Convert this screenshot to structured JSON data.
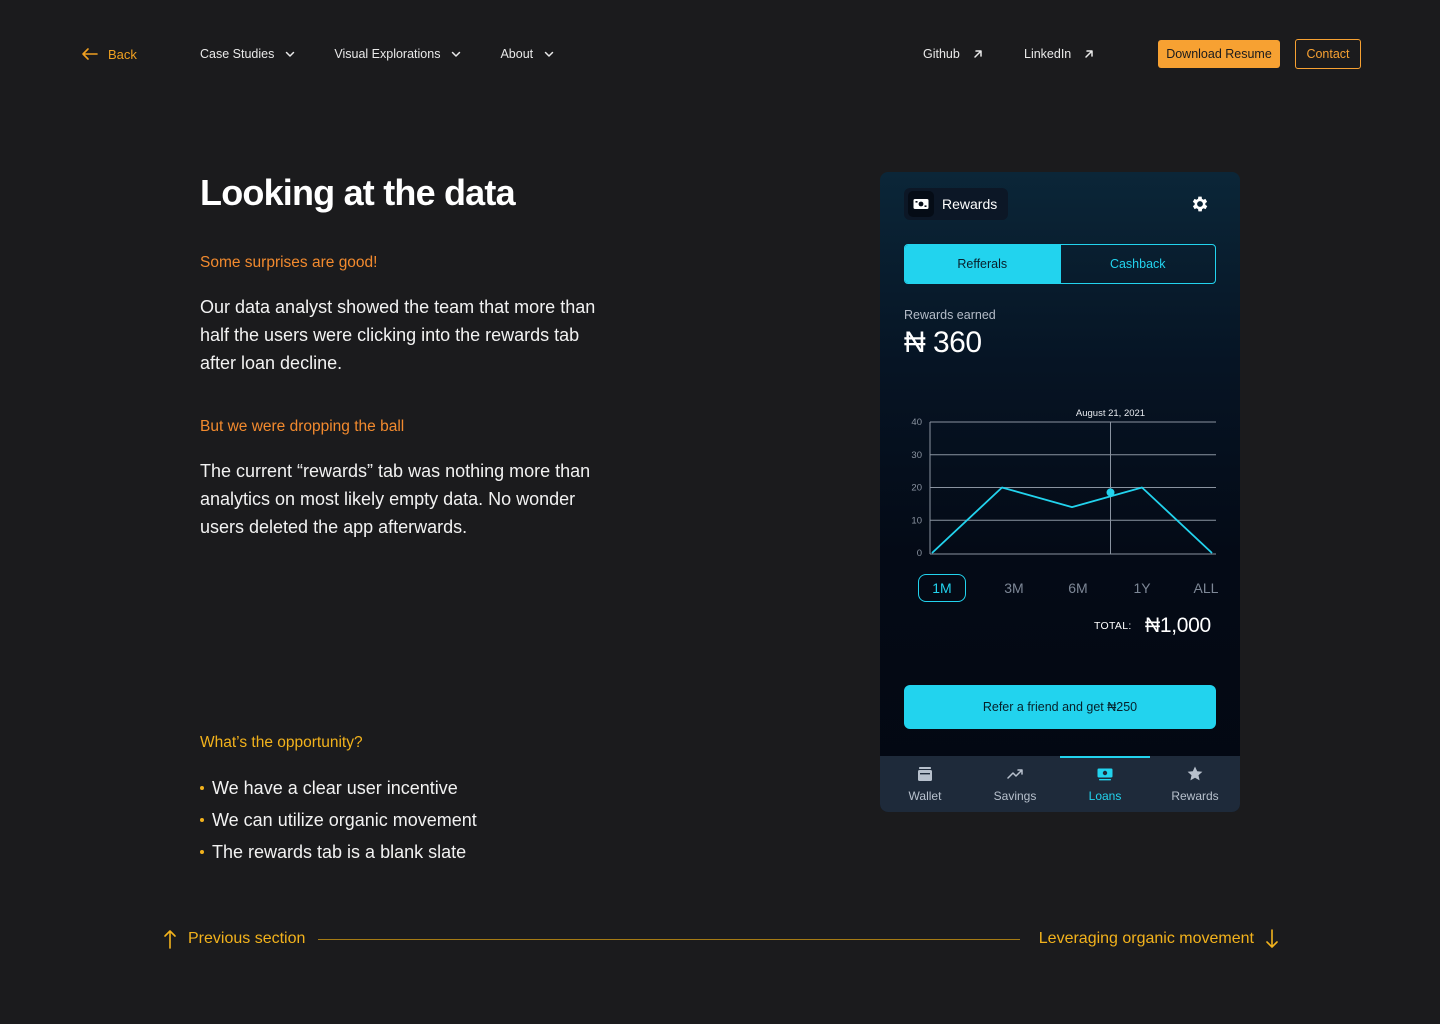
{
  "nav": {
    "back_label": "Back",
    "menu": [
      {
        "label": "Case Studies"
      },
      {
        "label": "Visual Explorations"
      },
      {
        "label": "About"
      }
    ],
    "github_label": "Github",
    "linkedin_label": "LinkedIn",
    "download_label": "Download Resume",
    "contact_label": "Contact"
  },
  "content": {
    "title": "Looking at the data",
    "subhead_1": "Some surprises are good!",
    "para_1": "Our data analyst showed the team that more than half the users were clicking into the rewards tab after loan decline.",
    "subhead_2": "But we were dropping the ball",
    "para_2": "The current “rewards” tab was nothing more than analytics on most likely empty data. No wonder users deleted the app afterwards.",
    "subhead_3": "What’s the opportunity?",
    "bullets": [
      "We have a clear user incentive",
      "We can utilize organic movement",
      "The rewards tab is a blank slate"
    ]
  },
  "phone": {
    "header_title": "Rewards",
    "tabs": [
      {
        "label": "Refferals",
        "active": true
      },
      {
        "label": "Cashback",
        "active": false
      }
    ],
    "earned_label": "Rewards earned",
    "earned_value": "₦ 360",
    "periods": [
      {
        "label": "1M",
        "active": true
      },
      {
        "label": "3M",
        "active": false
      },
      {
        "label": "6M",
        "active": false
      },
      {
        "label": "1Y",
        "active": false
      },
      {
        "label": "ALL",
        "active": false
      }
    ],
    "total_label": "TOTAL:",
    "total_value": "₦1,000",
    "cta_label": "Refer a friend and get ₦250",
    "tabbar": [
      {
        "label": "Wallet",
        "icon": "wallet-icon",
        "active": false
      },
      {
        "label": "Savings",
        "icon": "trend-up-icon",
        "active": false
      },
      {
        "label": "Loans",
        "icon": "cash-icon",
        "active": true
      },
      {
        "label": "Rewards",
        "icon": "star-icon",
        "active": false
      }
    ],
    "colors": {
      "accent": "#22d3ee",
      "line": "#22d3ee",
      "grid": "#8a93a0"
    }
  },
  "chart_data": {
    "type": "line",
    "x": [
      0,
      1,
      2,
      3,
      4
    ],
    "values": [
      0,
      20,
      14,
      20,
      0
    ],
    "ylim": [
      0,
      40
    ],
    "yticks": [
      0,
      10,
      20,
      30,
      40
    ],
    "highlight": {
      "x": 2.55,
      "y": 18.5,
      "label": "August 21, 2021"
    },
    "grid": true,
    "xlabel": "",
    "ylabel": ""
  },
  "footer": {
    "prev_label": "Previous section",
    "next_label": "Leveraging organic movement"
  }
}
